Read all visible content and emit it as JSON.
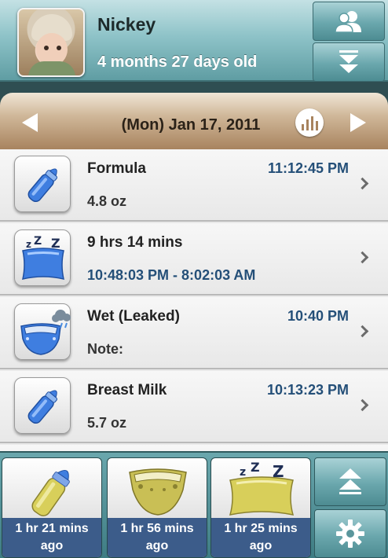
{
  "header": {
    "name": "Nickey",
    "age": "4 months 27 days old",
    "profiles_icon": "people-icon",
    "collapse_icon": "double-chevron-down-icon"
  },
  "datebar": {
    "date": "(Mon) Jan 17, 2011",
    "prev_icon": "triangle-left-icon",
    "next_icon": "triangle-right-icon",
    "chart_icon": "bar-chart-icon"
  },
  "entries": [
    {
      "icon": "bottle-icon",
      "title": "Formula",
      "time": "11:12:45 PM",
      "detail": "4.8 oz"
    },
    {
      "icon": "sleep-pillow-icon",
      "title": "9 hrs 14 mins",
      "time": "",
      "detail": "10:48:03 PM - 8:02:03 AM"
    },
    {
      "icon": "wet-diaper-icon",
      "title": "Wet (Leaked)",
      "time": "10:40 PM",
      "detail": "Note:"
    },
    {
      "icon": "bottle-icon",
      "title": "Breast Milk",
      "time": "10:13:23 PM",
      "detail": "5.7 oz"
    }
  ],
  "quick": [
    {
      "icon": "bottle-icon",
      "ago_line1": "1 hr 21 mins",
      "ago_line2": "ago"
    },
    {
      "icon": "diaper-icon",
      "ago_line1": "1 hr 56 mins",
      "ago_line2": "ago"
    },
    {
      "icon": "sleep-pillow-icon",
      "ago_line1": "1 hr 25 mins",
      "ago_line2": "ago"
    }
  ],
  "side": {
    "up_icon": "double-chevron-up-icon",
    "settings_icon": "gear-icon"
  },
  "colors": {
    "accent_teal": "#6aa7ad",
    "time_blue": "#244f78",
    "ago_blue": "#3c5c8a",
    "date_tan": "#d0b89a"
  }
}
